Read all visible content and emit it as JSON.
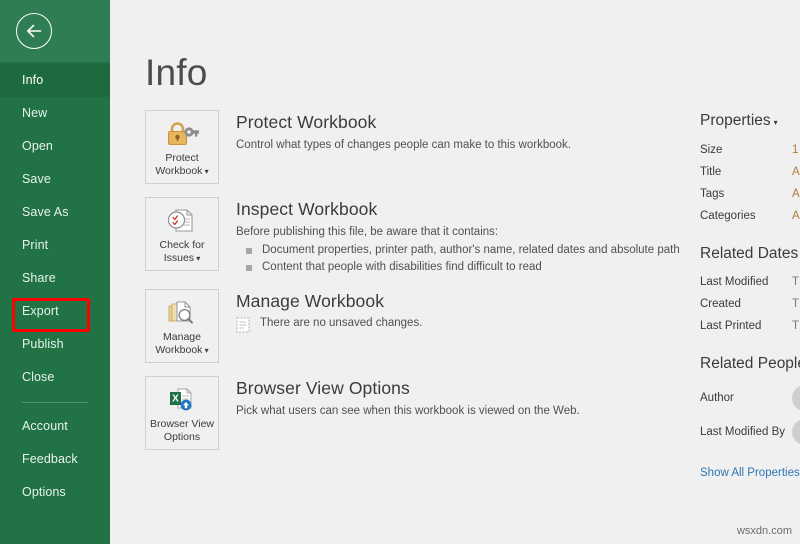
{
  "sidebar": {
    "back_icon": "back-arrow-icon",
    "items": [
      {
        "label": "Info",
        "selected": true
      },
      {
        "label": "New",
        "selected": false
      },
      {
        "label": "Open",
        "selected": false
      },
      {
        "label": "Save",
        "selected": false
      },
      {
        "label": "Save As",
        "selected": false
      },
      {
        "label": "Print",
        "selected": false
      },
      {
        "label": "Share",
        "selected": false
      },
      {
        "label": "Export",
        "selected": false,
        "highlighted": true
      },
      {
        "label": "Publish",
        "selected": false
      },
      {
        "label": "Close",
        "selected": false
      }
    ],
    "footer_items": [
      {
        "label": "Account"
      },
      {
        "label": "Feedback"
      },
      {
        "label": "Options"
      }
    ],
    "highlight_color": "#ff0000",
    "background_color": "#217346"
  },
  "main": {
    "title": "Info",
    "sections": [
      {
        "tile_label_line1": "Protect",
        "tile_label_line2": "Workbook",
        "tile_has_caret": true,
        "tile_icon": "lock-key-icon",
        "heading": "Protect Workbook",
        "description": "Control what types of changes people can make to this workbook.",
        "bullets": [],
        "note": ""
      },
      {
        "tile_label_line1": "Check for",
        "tile_label_line2": "Issues",
        "tile_has_caret": true,
        "tile_icon": "document-inspect-icon",
        "heading": "Inspect Workbook",
        "description": "Before publishing this file, be aware that it contains:",
        "bullets": [
          "Document properties, printer path, author's name, related dates and absolute path",
          "Content that people with disabilities find difficult to read"
        ],
        "note": ""
      },
      {
        "tile_label_line1": "Manage",
        "tile_label_line2": "Workbook",
        "tile_has_caret": true,
        "tile_icon": "document-stack-search-icon",
        "heading": "Manage Workbook",
        "description": "",
        "bullets": [],
        "note": "There are no unsaved changes."
      },
      {
        "tile_label_line1": "Browser View",
        "tile_label_line2": "Options",
        "tile_has_caret": false,
        "tile_icon": "excel-web-upload-icon",
        "heading": "Browser View Options",
        "description": "Pick what users can see when this workbook is viewed on the Web.",
        "bullets": [],
        "note": ""
      }
    ]
  },
  "properties": {
    "header": "Properties",
    "rows": [
      {
        "name": "Size",
        "value": "1"
      },
      {
        "name": "Title",
        "value": "A"
      },
      {
        "name": "Tags",
        "value": "A"
      },
      {
        "name": "Categories",
        "value": "A"
      }
    ],
    "related_dates": {
      "header": "Related Dates",
      "rows": [
        {
          "name": "Last Modified",
          "value": "T"
        },
        {
          "name": "Created",
          "value": "T"
        },
        {
          "name": "Last Printed",
          "value": "T"
        }
      ]
    },
    "related_people": {
      "header": "Related People",
      "rows": [
        {
          "name": "Author"
        },
        {
          "name": "Last Modified By"
        }
      ]
    },
    "show_all_link": "Show All Properties"
  },
  "watermark": "wsxdn.com"
}
